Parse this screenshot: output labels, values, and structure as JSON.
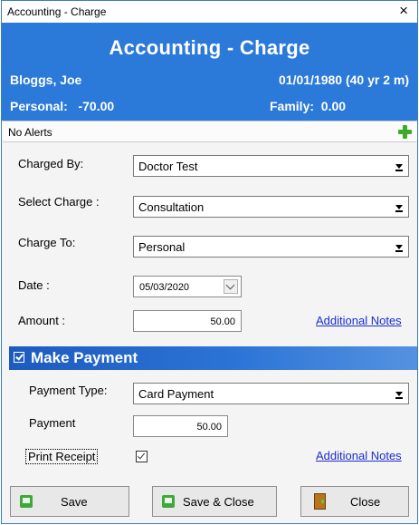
{
  "window": {
    "title": "Accounting - Charge",
    "close_glyph": "×"
  },
  "header": {
    "title": "Accounting - Charge",
    "patient_name": "Bloggs, Joe",
    "dob_age": "01/01/1980 (40 yr 2 m)",
    "personal_label": "Personal:",
    "personal_value": "-70.00",
    "family_label": "Family:",
    "family_value": "0.00"
  },
  "alerts": {
    "text": "No Alerts",
    "add_icon": "plus-icon"
  },
  "form": {
    "charged_by_label": "Charged By:",
    "charged_by_value": "Doctor Test",
    "select_charge_label": "Select Charge :",
    "select_charge_value": "Consultation",
    "charge_to_label": "Charge To:",
    "charge_to_value": "Personal",
    "date_label": "Date :",
    "date_value": "05/03/2020",
    "amount_label": "Amount :",
    "amount_value": "50.00",
    "additional_notes_link": "Additional Notes"
  },
  "payment": {
    "section_title": "Make Payment",
    "checked": true,
    "payment_type_label": "Payment Type:",
    "payment_type_value": "Card Payment",
    "payment_label": "Payment",
    "payment_value": "50.00",
    "print_receipt_label": "Print Receipt",
    "print_receipt_checked": true,
    "additional_notes_link": "Additional Notes"
  },
  "buttons": {
    "save_label": "Save",
    "save_close_label": "Save & Close",
    "close_label": "Close"
  },
  "colors": {
    "header_bg": "#2b79d8",
    "accent_green": "#3faa2a",
    "link": "#1a2ecc"
  }
}
